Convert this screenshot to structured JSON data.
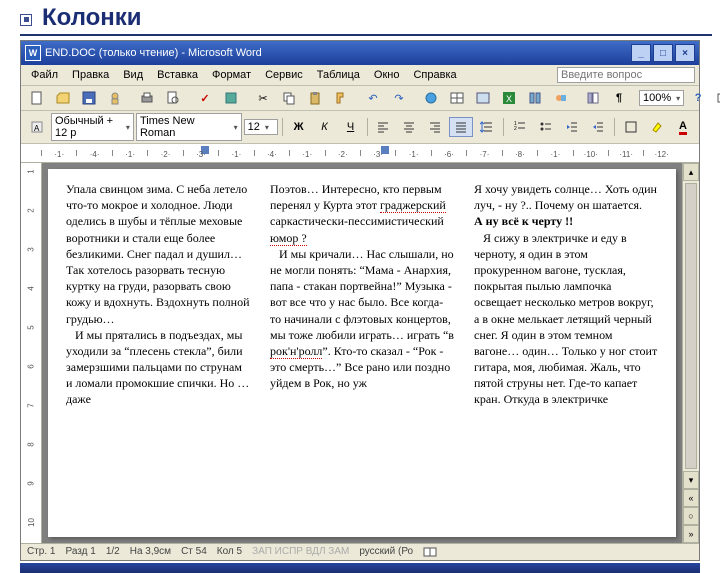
{
  "slide": {
    "title": "Колонки"
  },
  "title": "END.DOC (только чтение) - Microsoft Word",
  "menu": [
    "Файл",
    "Правка",
    "Вид",
    "Вставка",
    "Формат",
    "Сервис",
    "Таблица",
    "Окно",
    "Справка"
  ],
  "question_placeholder": "Введите вопрос",
  "toolbar1": {
    "zoom": "100%"
  },
  "toolbar2": {
    "style": "Обычный + 12 p",
    "font": "Times New Roman",
    "size": "12"
  },
  "ruler_h": [
    "1",
    "4",
    "1",
    "2",
    "3",
    "1",
    "4",
    "1",
    "2",
    "3",
    "1",
    "6",
    "7",
    "8",
    "1",
    "10",
    "1",
    "11",
    "1",
    "12"
  ],
  "ruler_v": [
    "1",
    "2",
    "3",
    "4",
    "5",
    "6",
    "7",
    "8",
    "9",
    "10"
  ],
  "columns": {
    "c1": "Упала свинцом зима. С неба летело что-то мокрое и холодное. Люди оделись в шубы и тёплые меховые воротники и стали еще более безликими. Снег падал и душил… Так хотелось разорвать тесную куртку на груди, разорвать свою кожу и вдохнуть. Вздохнуть полной грудью…\n   И мы прятались в подъездах, мы уходили за “плесень стекла”, били замерзшими пальцами по струнам и ломали промокшие спички. Но … даже",
    "c2_a": "Поэтов… Интересно, кто первым перенял у Курта этот ",
    "c2_hl1": "граджерский",
    "c2_b": " саркастически-пессимистический ",
    "c2_hl2": "юмор ?",
    "c2_c": "\n   И мы кричали… Нас слышали, но не могли понять: “Мама - Анархия, папа - стакан портвейна!” Музыка - вот все что у нас было. Все когда-то начинали с флэтовых концертов, мы тоже любили играть… играть “в ",
    "c2_hl3": "рок'н'ролл",
    "c2_d": "”. Кто-то сказал - “Рок - это смерть…” Все рано или поздно уйдем в Рок, но уж",
    "c3_a": "Я хочу увидеть солнце… Хоть один луч, - ну ?.. Почему он шатается.\n",
    "c3_bold": "А ну всё к черту !!",
    "c3_b": "\n   Я сижу в электричке и еду в черноту, я один в этом прокуренном вагоне, тусклая, покрытая пылью лампочка освещает несколько метров вокруг, а в окне мелькает летящий черный снег. Я один в этом темном вагоне… один… Только у ног стоит гитара, моя, любимая. Жаль, что пятой струны нет. Где-то капает кран. Откуда в электричке"
  },
  "status": {
    "page": "Стр. 1",
    "section": "Разд 1",
    "pages": "1/2",
    "at": "На 3,9см",
    "line": "Ст 54",
    "col": "Кол 5",
    "modes": "ЗАП ИСПР ВДЛ ЗАМ",
    "lang": "русский (Ро"
  }
}
